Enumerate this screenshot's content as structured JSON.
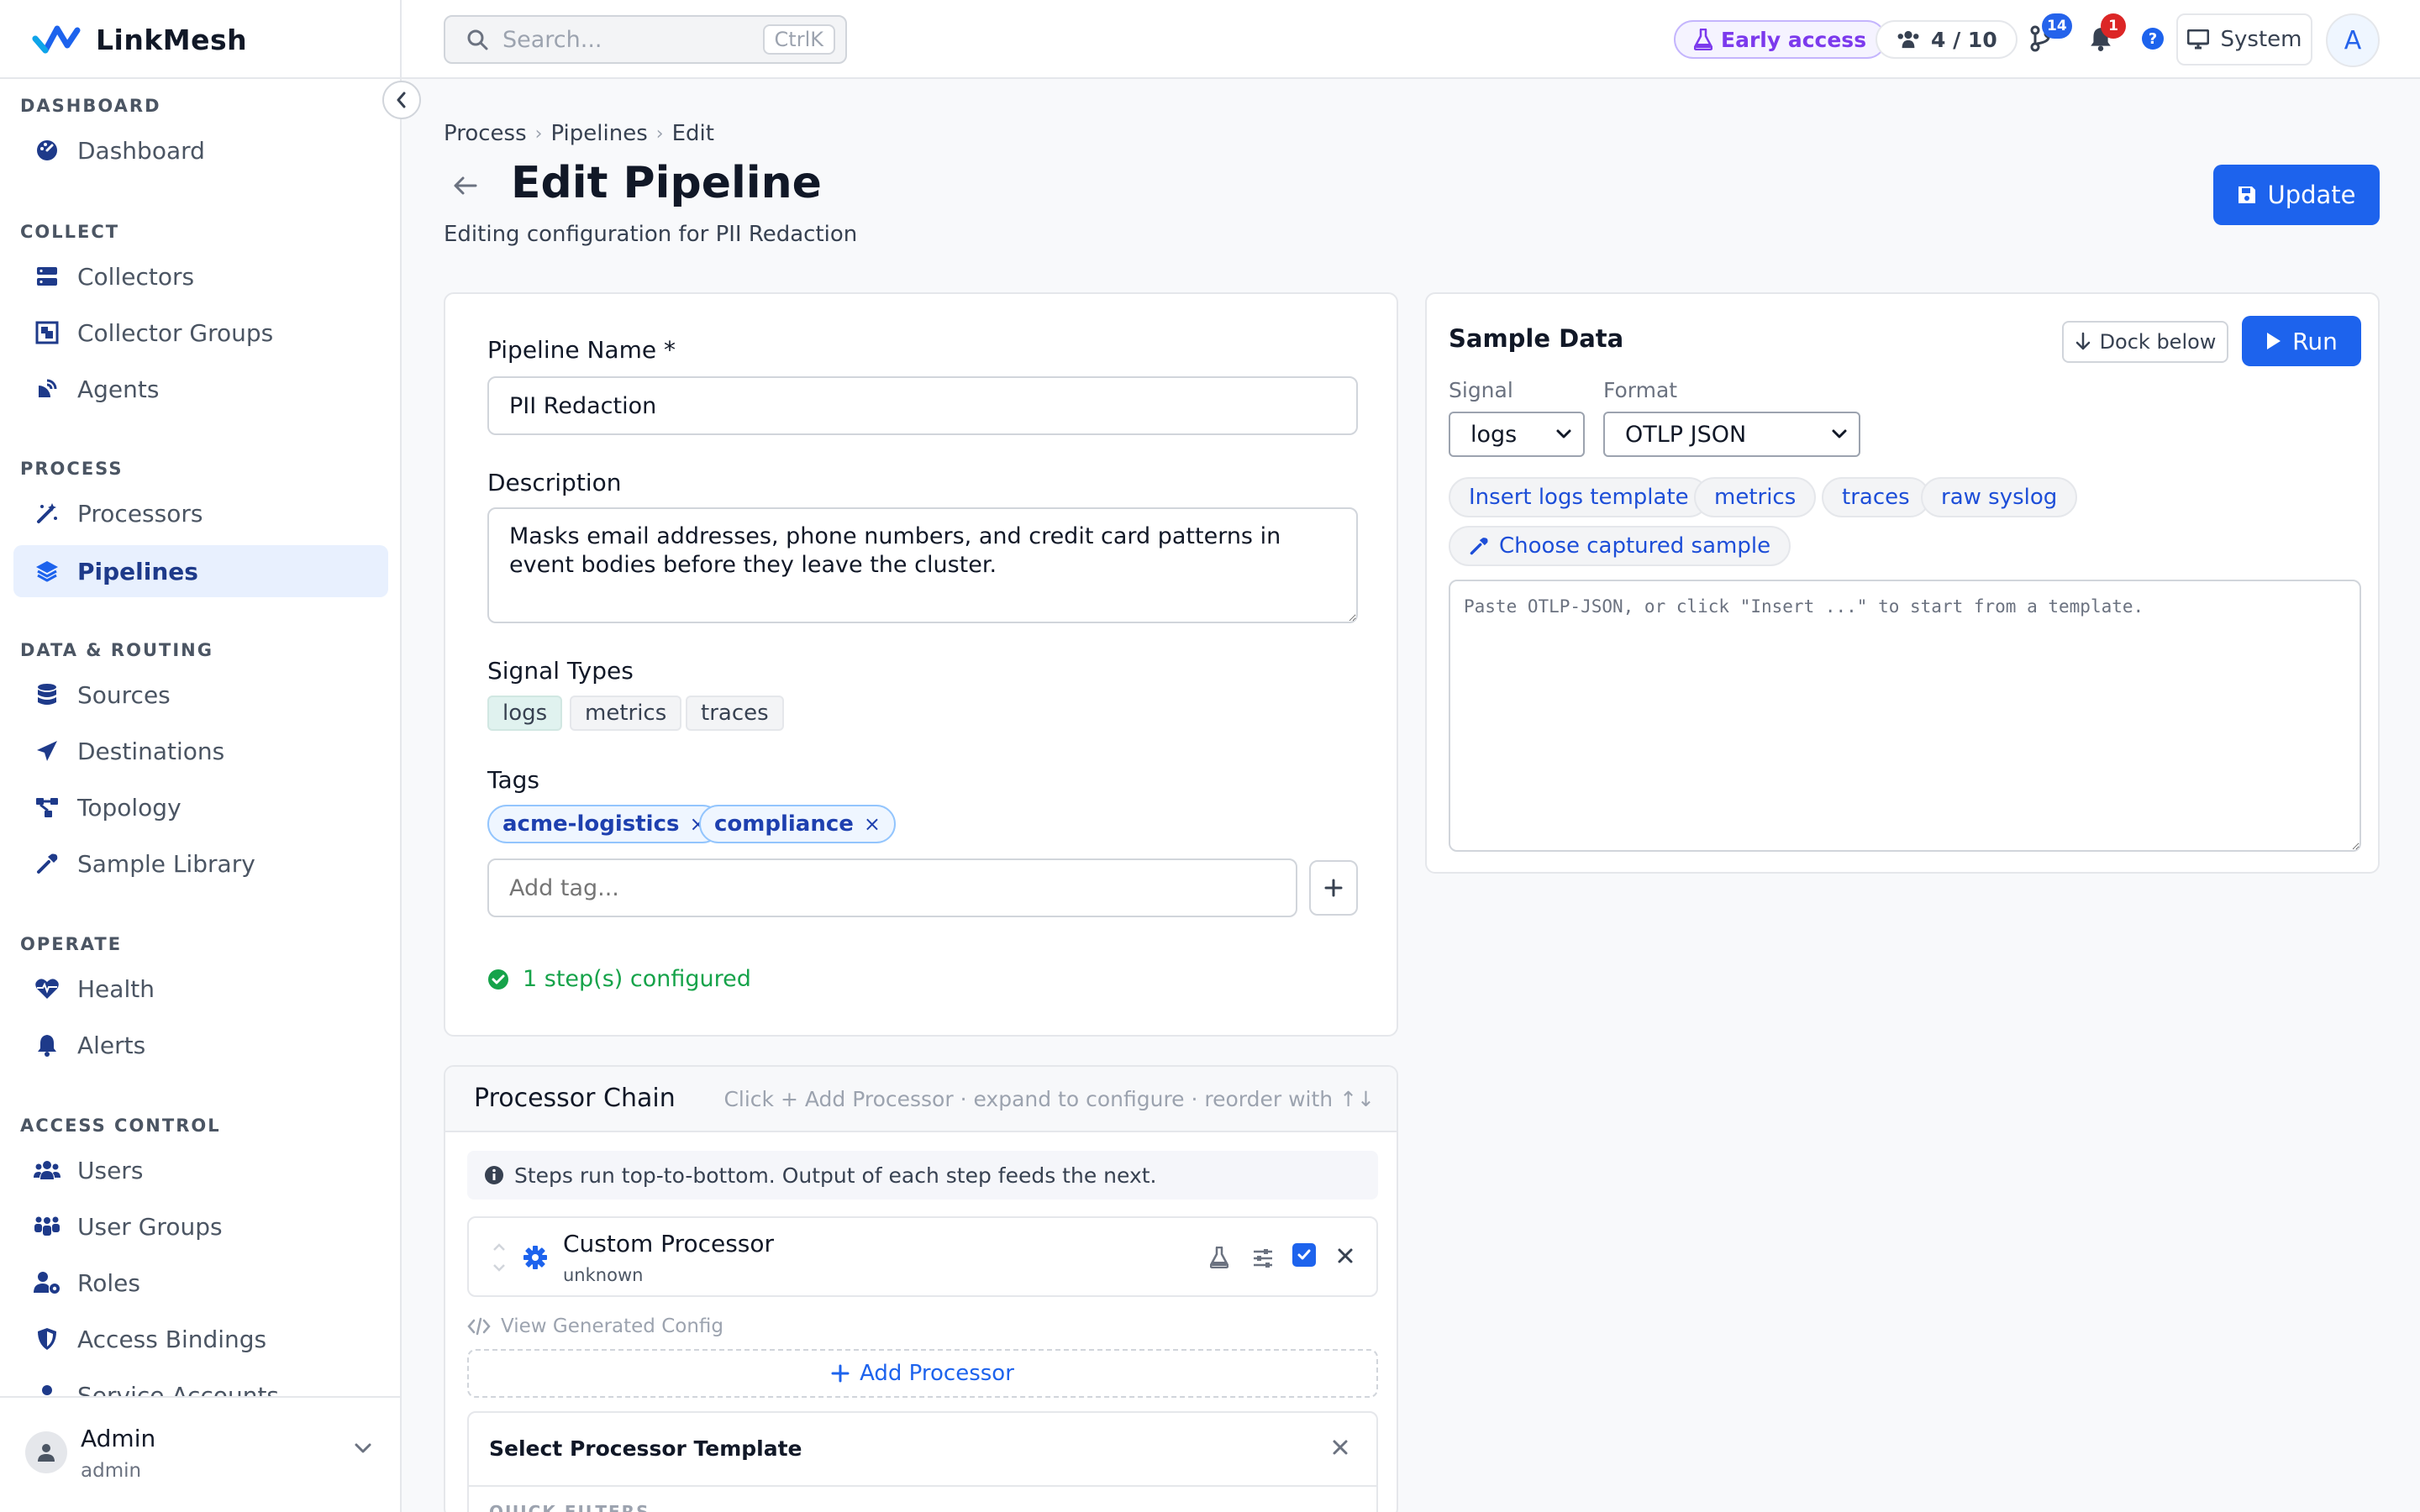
{
  "app": {
    "name": "LinkMesh"
  },
  "sidebar": {
    "sections": {
      "dashboard": "DASHBOARD",
      "collect": "COLLECT",
      "process": "PROCESS",
      "data_routing": "DATA & ROUTING",
      "operate": "OPERATE",
      "access_control": "ACCESS CONTROL"
    },
    "items": {
      "dashboard": "Dashboard",
      "collectors": "Collectors",
      "collector_groups": "Collector Groups",
      "agents": "Agents",
      "processors": "Processors",
      "pipelines": "Pipelines",
      "sources": "Sources",
      "destinations": "Destinations",
      "topology": "Topology",
      "sample_library": "Sample Library",
      "health": "Health",
      "alerts": "Alerts",
      "users": "Users",
      "user_groups": "User Groups",
      "roles": "Roles",
      "access_bindings": "Access Bindings",
      "service_accounts": "Service Accounts"
    },
    "user": {
      "name": "Admin",
      "role": "admin"
    }
  },
  "topbar": {
    "search_placeholder": "Search...",
    "search_shortcut": "CtrlK",
    "early_access": "Early access",
    "users_count": "4 / 10",
    "git_badge": "14",
    "notif_badge": "1",
    "help": "?",
    "theme": "System",
    "avatar_initial": "A"
  },
  "breadcrumb": {
    "process": "Process",
    "pipelines": "Pipelines",
    "edit": "Edit"
  },
  "header": {
    "title": "Edit Pipeline",
    "subtitle": "Editing configuration for PII Redaction",
    "update_label": "Update"
  },
  "form": {
    "name_label": "Pipeline Name *",
    "name_value": "PII Redaction",
    "description_label": "Description",
    "description_value": "Masks email addresses, phone numbers, and credit card patterns in event bodies before they leave the cluster.",
    "signal_types_label": "Signal Types",
    "signal_types": [
      "logs",
      "metrics",
      "traces"
    ],
    "tags_label": "Tags",
    "tags": [
      "acme-logistics",
      "compliance"
    ],
    "tag_remove": "×",
    "tag_placeholder": "Add tag...",
    "status": "1 step(s) configured"
  },
  "chain": {
    "title": "Processor Chain",
    "hint": "Click + Add Processor · expand to configure · reorder with ↑↓",
    "info": "Steps run top-to-bottom. Output of each step feeds the next.",
    "processor": {
      "name": "Custom Processor",
      "type": "unknown",
      "enabled": true
    },
    "view_config": "View Generated Config",
    "add_processor": "Add Processor",
    "template_title": "Select Processor Template",
    "quick_filters": "QUICK FILTERS"
  },
  "sample": {
    "title": "Sample Data",
    "dock_label": "Dock below",
    "run_label": "Run",
    "signal_label": "Signal",
    "signal_value": "logs",
    "format_label": "Format",
    "format_value": "OTLP JSON",
    "templates": [
      "Insert logs template",
      "metrics",
      "traces",
      "raw syslog"
    ],
    "captured": "Choose captured sample",
    "placeholder": "Paste OTLP-JSON, or click \"Insert ...\" to start from a template."
  },
  "colors": {
    "primary": "#1d63ed",
    "accent_purple": "#7c3aed",
    "success": "#16a34a",
    "active_bg": "#e8f0fe",
    "danger": "#dc2626"
  }
}
